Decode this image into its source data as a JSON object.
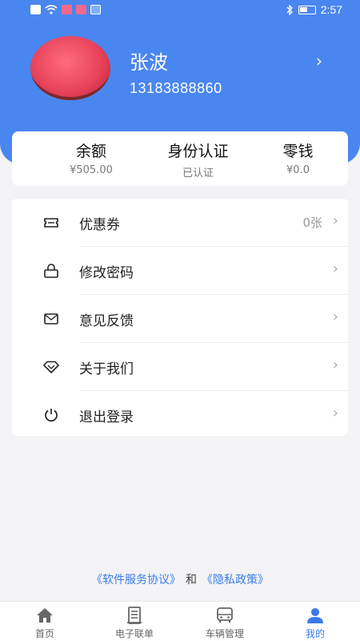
{
  "status_bar": {
    "time": "2:57"
  },
  "profile": {
    "name": "张波",
    "phone": "13183888860",
    "arrow": "›"
  },
  "summary": {
    "balance_label": "余额",
    "balance_value": "¥505.00",
    "identity_label": "身份认证",
    "identity_value": "已认证",
    "change_label": "零钱",
    "change_value": "¥0.0"
  },
  "menu": {
    "items": [
      {
        "label": "优惠券",
        "icon": "ticket-icon",
        "extra": "0张"
      },
      {
        "label": "修改密码",
        "icon": "lock-icon"
      },
      {
        "label": "意见反馈",
        "icon": "mail-icon"
      },
      {
        "label": "关于我们",
        "icon": "diamond-icon"
      },
      {
        "label": "退出登录",
        "icon": "power-icon"
      }
    ],
    "arrow": "›"
  },
  "footer": {
    "service_agreement": "《软件服务协议》",
    "and_text": "和",
    "privacy_policy": "《隐私政策》"
  },
  "tabs": [
    {
      "label": "首页",
      "icon": "home-icon"
    },
    {
      "label": "电子联单",
      "icon": "document-icon"
    },
    {
      "label": "车辆管理",
      "icon": "bus-icon"
    },
    {
      "label": "我的",
      "icon": "user-icon",
      "active": true
    }
  ],
  "colors": {
    "accent": "#4a86f0",
    "link": "#3a7be8"
  }
}
